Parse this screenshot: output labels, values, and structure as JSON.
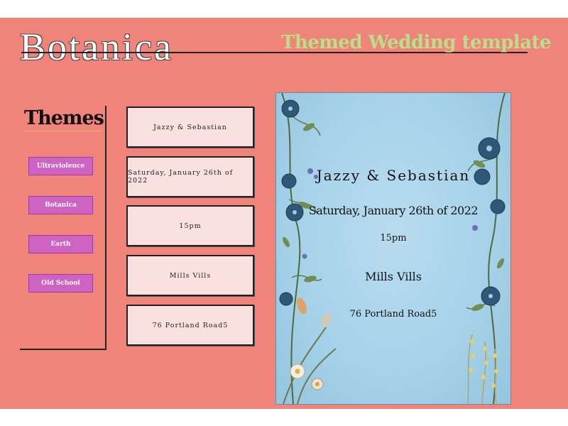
{
  "header": {
    "brand": "Botanica",
    "subtitle": "Themed Wedding template"
  },
  "themes": {
    "title": "Themes",
    "items": [
      {
        "label": "Ultraviolence"
      },
      {
        "label": "Botanica"
      },
      {
        "label": "Earth"
      },
      {
        "label": "Old School"
      }
    ]
  },
  "fields": {
    "names": "Jazzy & Sebastian",
    "date": "Saturday, January 26th of 2022",
    "time": "15pm",
    "venue": "Mills Vills",
    "address": "76  Portland Road5"
  },
  "preview": {
    "names": "Jazzy & Sebastian",
    "date": "Saturday, January 26th of 2022",
    "time": "15pm",
    "venue": "Mills Vills",
    "address": "76 Portland Road5"
  },
  "colors": {
    "page_bg": "#f0837a",
    "accent_green": "#b8e08a",
    "theme_button": "#cf63c4",
    "field_bg": "#fbe0e0",
    "card_bg": "#a7d2ea"
  }
}
